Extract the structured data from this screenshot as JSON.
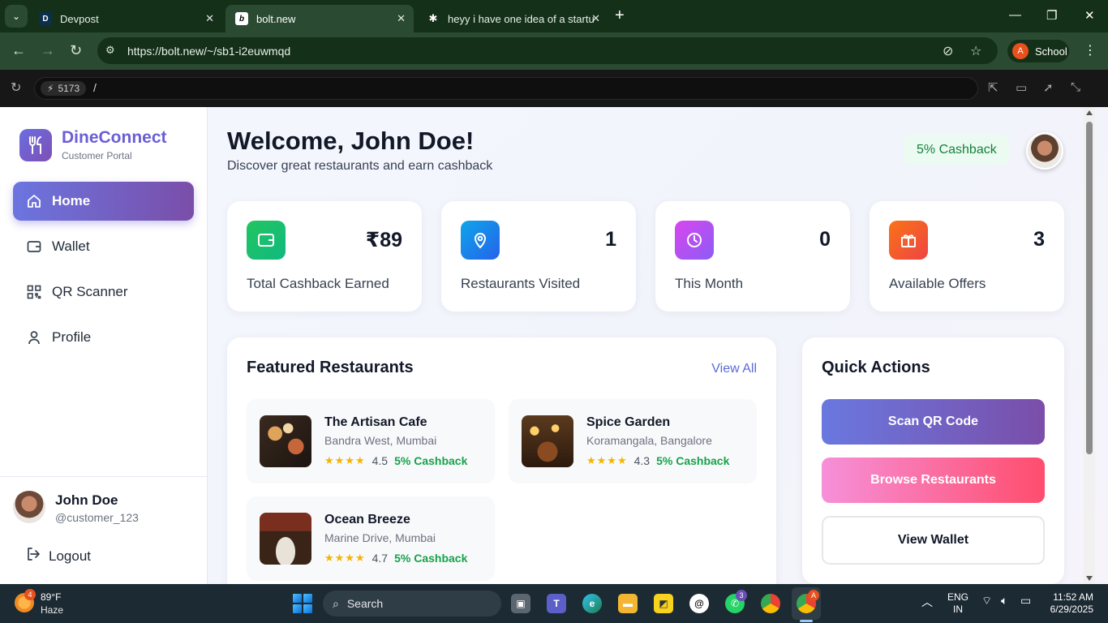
{
  "browser": {
    "tabs": [
      {
        "label": "Devpost",
        "favicon": "D"
      },
      {
        "label": "bolt.new",
        "favicon": "b"
      },
      {
        "label": "heyy i have one idea of a startu",
        "favicon": "✱"
      }
    ],
    "url": "https://bolt.new/~/sb1-i2euwmqd",
    "profile_label": "School",
    "profile_initial": "A"
  },
  "devbar": {
    "port": "5173",
    "path": "/"
  },
  "sidebar": {
    "brand": "DineConnect",
    "brand_sub": "Customer Portal",
    "items": [
      {
        "label": "Home",
        "icon": "home-icon"
      },
      {
        "label": "Wallet",
        "icon": "wallet-icon"
      },
      {
        "label": "QR Scanner",
        "icon": "qr-icon"
      },
      {
        "label": "Profile",
        "icon": "user-icon"
      }
    ],
    "user": {
      "name": "John Doe",
      "handle": "@customer_123"
    },
    "logout_label": "Logout"
  },
  "header": {
    "welcome": "Welcome, John Doe!",
    "subtitle": "Discover great restaurants and earn cashback",
    "cashback_badge": "5% Cashback"
  },
  "stats": [
    {
      "value": "₹89",
      "label": "Total Cashback Earned",
      "icon": "wallet-icon",
      "color": "#10b981"
    },
    {
      "value": "1",
      "label": "Restaurants Visited",
      "icon": "map-pin-icon",
      "color": "#0ea5e9"
    },
    {
      "value": "0",
      "label": "This Month",
      "icon": "clock-icon",
      "color": "#a855f7"
    },
    {
      "value": "3",
      "label": "Available Offers",
      "icon": "gift-icon",
      "color": "#f97316"
    }
  ],
  "featured": {
    "title": "Featured Restaurants",
    "view_all": "View All",
    "restaurants": [
      {
        "name": "The Artisan Cafe",
        "location": "Bandra West, Mumbai",
        "stars": "★★★★",
        "rating": "4.5",
        "cashback": "5% Cashback"
      },
      {
        "name": "Spice Garden",
        "location": "Koramangala, Bangalore",
        "stars": "★★★★",
        "rating": "4.3",
        "cashback": "5% Cashback"
      },
      {
        "name": "Ocean Breeze",
        "location": "Marine Drive, Mumbai",
        "stars": "★★★★",
        "rating": "4.7",
        "cashback": "5% Cashback"
      }
    ]
  },
  "quick_actions": {
    "title": "Quick Actions",
    "scan": "Scan QR Code",
    "browse": "Browse Restaurants",
    "wallet": "View Wallet"
  },
  "taskbar": {
    "weather_temp": "89°F",
    "weather_cond": "Haze",
    "weather_badge": "4",
    "search_label": "Search",
    "whatsapp_badge": "3",
    "chrome_badge": "A",
    "lang_top": "ENG",
    "lang_bottom": "IN",
    "time": "11:52 AM",
    "date": "6/29/2025"
  },
  "colors": {
    "brand": "#6a5ed6",
    "accent_gradient_start": "#6b75df",
    "accent_gradient_end": "#7a4ea9",
    "cashback_green": "#16a34a"
  }
}
